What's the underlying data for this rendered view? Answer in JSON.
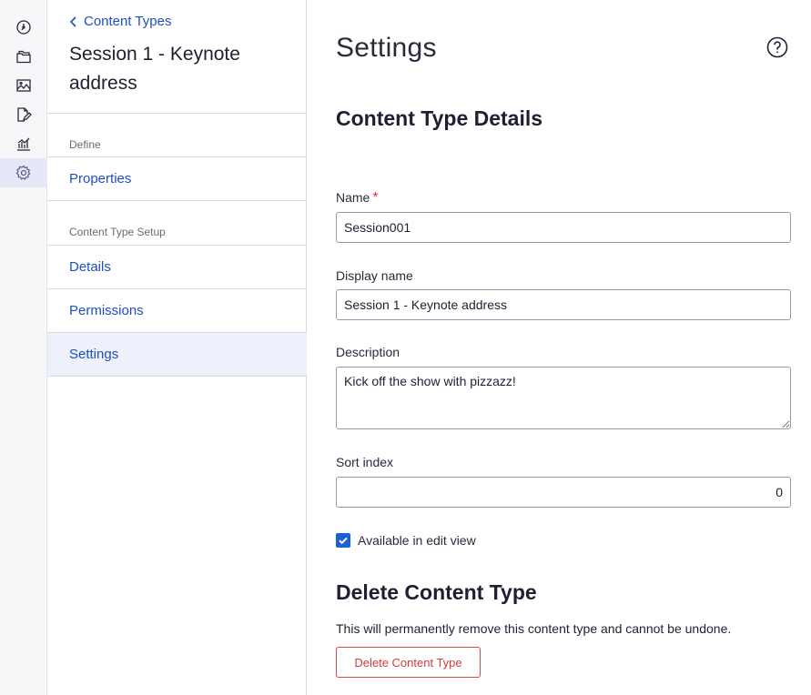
{
  "rail": {
    "icons": [
      "dashboard-icon",
      "folders-icon",
      "media-icon",
      "edit-document-icon",
      "analytics-icon",
      "gear-icon"
    ],
    "active": "gear-icon"
  },
  "subnav": {
    "back_label": "Content Types",
    "title": "Session 1 - Keynote address",
    "sections": [
      {
        "label": "Define",
        "items": [
          "Properties"
        ]
      },
      {
        "label": "Content Type Setup",
        "items": [
          "Details",
          "Permissions",
          "Settings"
        ]
      }
    ],
    "active_item": "Settings"
  },
  "main": {
    "page_title": "Settings",
    "details_title": "Content Type Details",
    "name_label": "Name",
    "name_required_mark": "*",
    "name_value": "Session001",
    "display_name_label": "Display name",
    "display_name_value": "Session 1 - Keynote address",
    "description_label": "Description",
    "description_value": "Kick off the show with pizzazz!",
    "sort_index_label": "Sort index",
    "sort_index_value": "0",
    "available_label": "Available in edit view",
    "available_checked": true,
    "delete_title": "Delete Content Type",
    "delete_warning": "This will permanently remove this content type and cannot be undone.",
    "delete_button": "Delete Content Type"
  },
  "colors": {
    "link": "#1d4fc4",
    "active_bg": "#eef0fb",
    "checkbox": "#1d5fd6",
    "danger": "#d43b3b"
  }
}
